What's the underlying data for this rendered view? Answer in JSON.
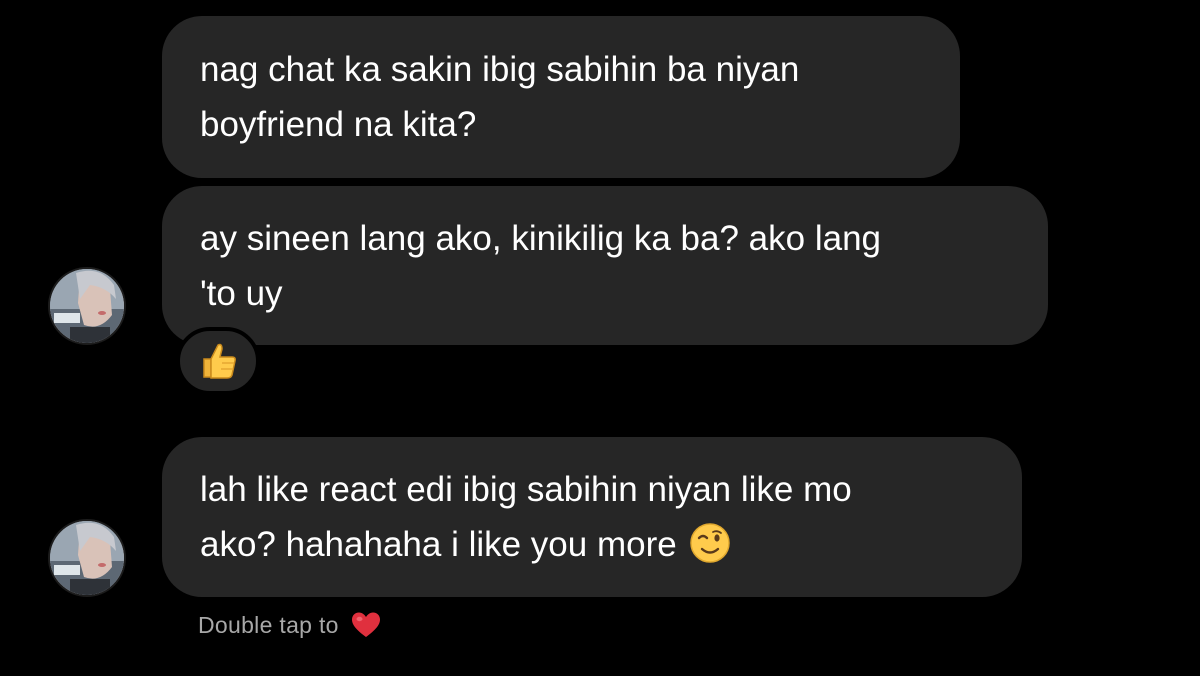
{
  "messages": [
    {
      "id": "msg1",
      "line1": "nag chat ka sakin ibig sabihin ba niyan",
      "line2": "boyfriend na kita?"
    },
    {
      "id": "msg2",
      "line1": "ay sineen lang ako, kinikilig ka ba? ako lang",
      "line2": "'to uy",
      "reaction_icon": "thumbs-up-emoji"
    },
    {
      "id": "msg3",
      "line1": "lah like react edi ibig sabihin niyan like mo",
      "line2": "ako? hahahaha i like you more",
      "trailing_emoji_icon": "winking-face-emoji"
    }
  ],
  "footer": {
    "hint_text": "Double tap to",
    "hint_icon": "red-heart-icon"
  },
  "colors": {
    "background": "#000000",
    "bubble": "#262626",
    "text": "#ffffff",
    "hint_text": "#a8a8a8",
    "heart": "#e0303e"
  }
}
